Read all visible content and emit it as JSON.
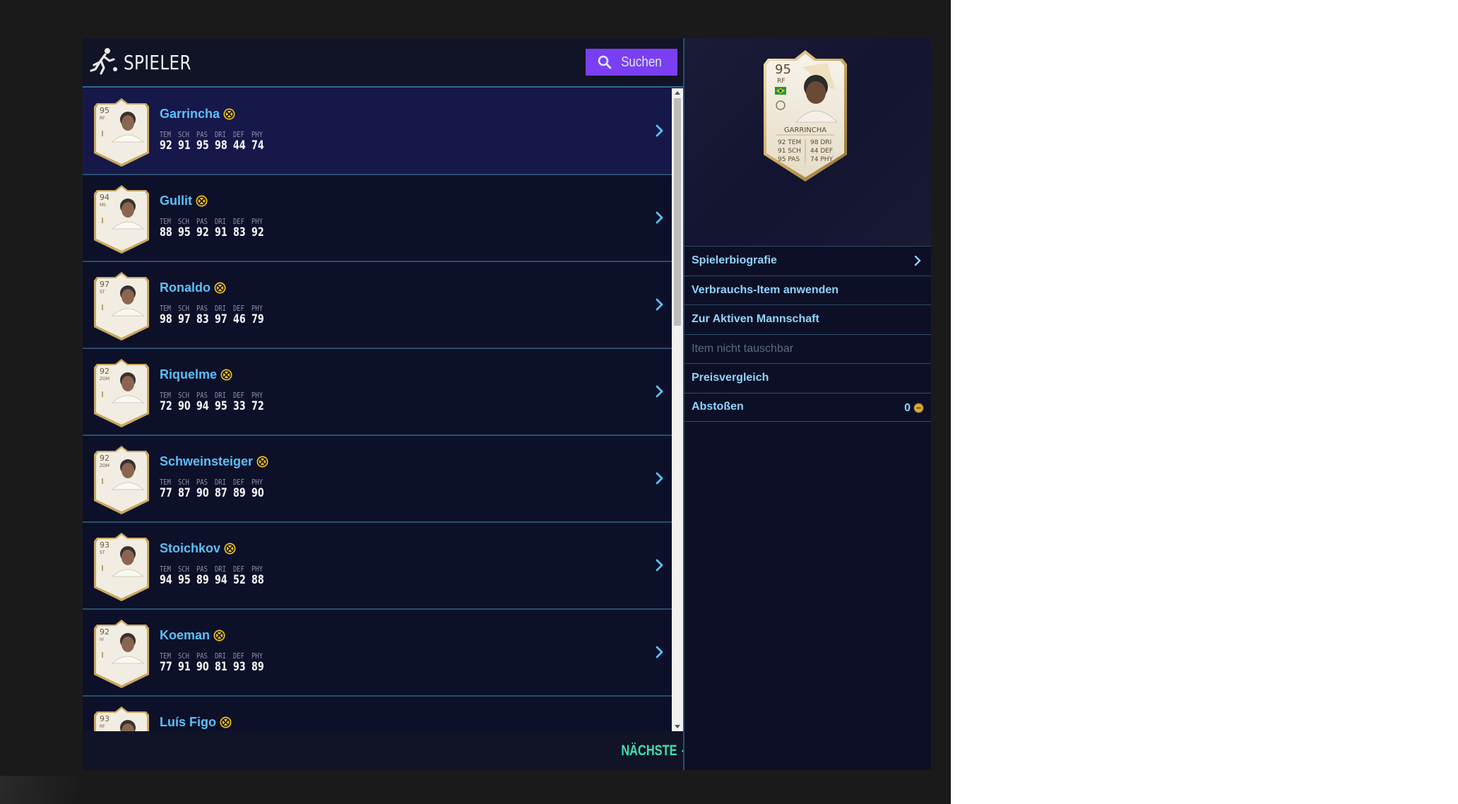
{
  "header": {
    "title": "SPIELER",
    "search_label": "Suchen"
  },
  "stat_labels": [
    "TEM",
    "SCH",
    "PAS",
    "DRI",
    "DEF",
    "PHY"
  ],
  "players": [
    {
      "name": "Garrincha",
      "rating": "95",
      "position": "RF",
      "stats": [
        "92",
        "91",
        "95",
        "98",
        "44",
        "74"
      ],
      "selected": true
    },
    {
      "name": "Gullit",
      "rating": "94",
      "position": "MS",
      "stats": [
        "88",
        "95",
        "92",
        "91",
        "83",
        "92"
      ]
    },
    {
      "name": "Ronaldo",
      "rating": "97",
      "position": "ST",
      "stats": [
        "98",
        "97",
        "83",
        "97",
        "46",
        "79"
      ]
    },
    {
      "name": "Riquelme",
      "rating": "92",
      "position": "ZOM",
      "stats": [
        "72",
        "90",
        "94",
        "95",
        "33",
        "72"
      ]
    },
    {
      "name": "Schweinsteiger",
      "rating": "92",
      "position": "ZDM",
      "stats": [
        "77",
        "87",
        "90",
        "87",
        "89",
        "90"
      ]
    },
    {
      "name": "Stoichkov",
      "rating": "93",
      "position": "ST",
      "stats": [
        "94",
        "95",
        "89",
        "94",
        "52",
        "88"
      ]
    },
    {
      "name": "Koeman",
      "rating": "92",
      "position": "IV",
      "stats": [
        "77",
        "91",
        "90",
        "81",
        "93",
        "89"
      ]
    },
    {
      "name": "Luís Figo",
      "rating": "93",
      "position": "RF",
      "stats": []
    }
  ],
  "footer": {
    "next_label": "NÄCHSTE"
  },
  "detail": {
    "card": {
      "rating": "95",
      "position": "RF",
      "name": "GARRINCHA",
      "stat_lines": [
        {
          "left": "92 TEM",
          "right": "98 DRI"
        },
        {
          "left": "91 SCH",
          "right": "44 DEF"
        },
        {
          "left": "95 PAS",
          "right": "74 PHY"
        }
      ]
    },
    "actions": [
      {
        "label": "Spielerbiografie"
      },
      {
        "label": "Verbrauchs-Item anwenden"
      },
      {
        "label": "Zur Aktiven Mannschaft"
      },
      {
        "label": "Item nicht tauschbar"
      },
      {
        "label": "Preisvergleich"
      },
      {
        "label": "Abstoßen",
        "price": "0"
      }
    ]
  },
  "colors": {
    "accent_purple": "#7a3ff2",
    "link_blue": "#5bc0f8",
    "next_green": "#3fe0b0",
    "untradeable_badge": "#f0c020"
  }
}
